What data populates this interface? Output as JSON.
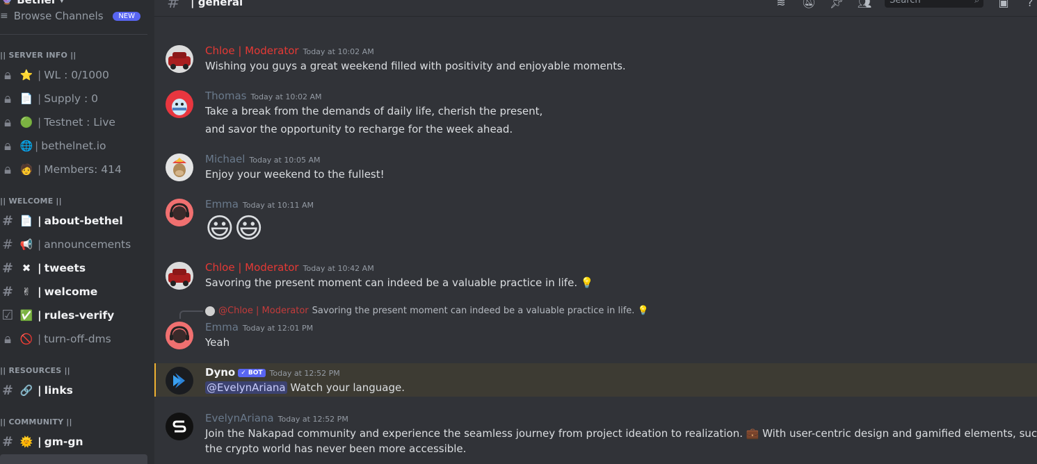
{
  "server": {
    "name": "Bethel"
  },
  "sidebar": {
    "browse_label": "Browse Channels",
    "new_badge": "NEW",
    "categories": [
      {
        "label": "|| SERVER INFO ||",
        "channels": [
          {
            "emoji": "⭐",
            "label": "WL : 0/1000"
          },
          {
            "emoji": "📄",
            "label": "Supply : 0"
          },
          {
            "emoji": "🟢",
            "label": "Testnet : Live"
          },
          {
            "emoji": "🌐",
            "label": "bethelnet.io"
          },
          {
            "emoji": "🧑",
            "label": "Members: 414"
          }
        ]
      },
      {
        "label": "|| WELCOME ||",
        "channels": [
          {
            "emoji": "📄",
            "label": "about-bethel"
          },
          {
            "emoji": "📢",
            "label": "announcements"
          },
          {
            "emoji": "✖",
            "label": "tweets"
          },
          {
            "emoji": "✌",
            "label": "welcome"
          },
          {
            "emoji": "✅",
            "label": "rules-verify"
          },
          {
            "emoji": "🚫",
            "label": "turn-off-dms"
          }
        ]
      },
      {
        "label": "|| RESOURCES ||",
        "channels": [
          {
            "emoji": "🔗",
            "label": "links"
          }
        ]
      },
      {
        "label": "|| COMMUNITY ||",
        "channels": [
          {
            "emoji": "🌞",
            "label": "gm-gn"
          }
        ]
      }
    ]
  },
  "topbar": {
    "channel_name": "| general",
    "search_placeholder": "Search"
  },
  "messages": [
    {
      "author": "Chloe | Moderator",
      "time": "Today at 10:02 AM",
      "lines": [
        "Wishing you guys a great weekend filled with positivity and enjoyable moments."
      ]
    },
    {
      "author": "Thomas",
      "time": "Today at 10:02 AM",
      "lines": [
        "Take a break from the demands of daily life, cherish the present,",
        "and savor the opportunity to recharge for the week ahead."
      ]
    },
    {
      "author": "Michael",
      "time": "Today at 10:05 AM",
      "lines": [
        "Enjoy your weekend to the fullest!"
      ]
    },
    {
      "author": "Emma",
      "time": "Today at 10:11 AM",
      "lines": [
        "😃😃"
      ]
    },
    {
      "author": "Chloe | Moderator",
      "time": "Today at 10:42 AM",
      "lines": [
        "Savoring the present moment can indeed be a valuable practice in life. 💡"
      ]
    },
    {
      "author": "Emma",
      "time": "Today at 12:01 PM",
      "reply_author": "@Chloe | Moderator",
      "reply_text": "Savoring the present moment can indeed be a valuable practice in life. 💡",
      "lines": [
        "Yeah"
      ]
    },
    {
      "author": "Dyno",
      "badge": "✓ BOT",
      "time": "Today at 12:52 PM",
      "mention": "@EvelynAriana",
      "lines": [
        "Watch your language."
      ]
    },
    {
      "author": "EvelynAriana",
      "time": "Today at 12:52 PM",
      "lines": [
        "Join the Nakapad community and experience the seamless journey from project ideation to realization. 💼 With user-centric design and gamified elements, success in",
        "the crypto world has never been more accessible."
      ]
    }
  ],
  "colors": {
    "moderator": "#e53935",
    "mention_bg": "#3c4270",
    "bot_badge": "#5865f2",
    "highlight": "#f0b232"
  }
}
